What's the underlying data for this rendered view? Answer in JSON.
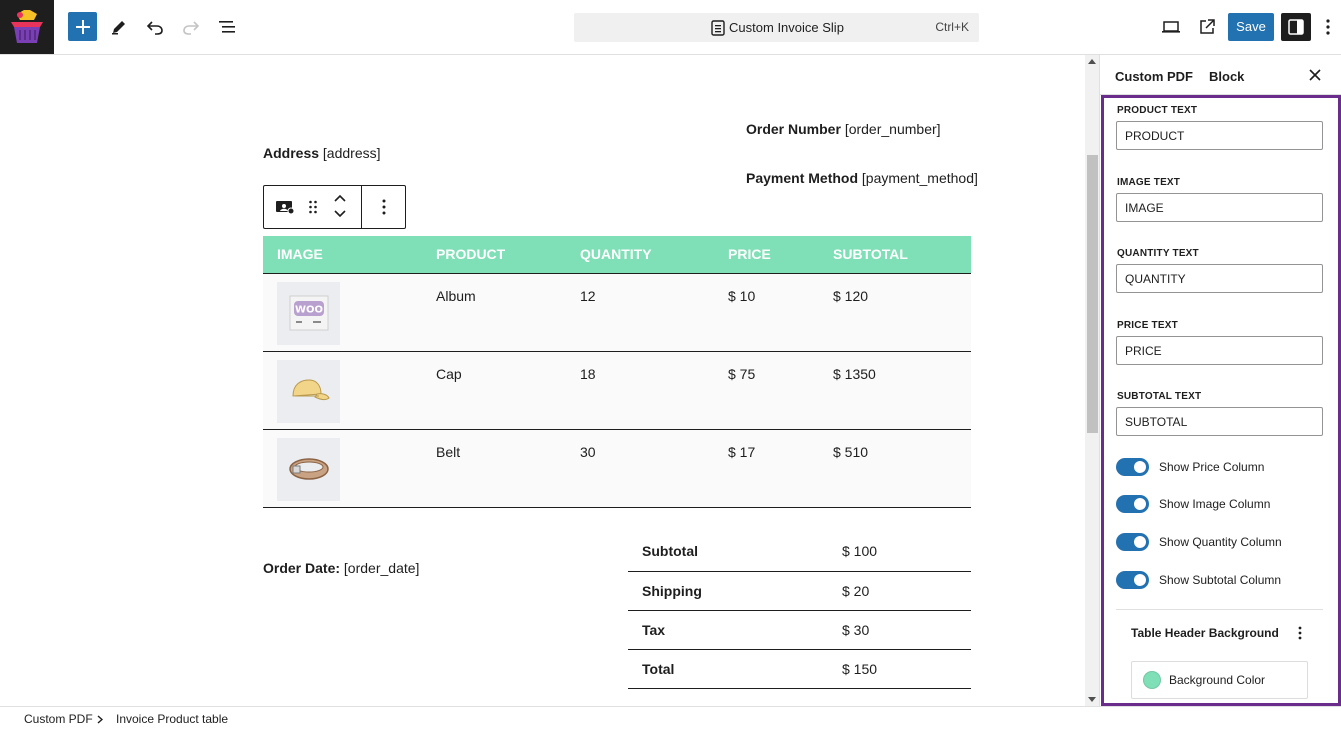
{
  "header": {
    "document_title": "Custom Invoice Slip",
    "shortcut": "Ctrl+K",
    "save_label": "Save"
  },
  "canvas": {
    "order_number": {
      "label": "Order Number",
      "value": "[order_number]"
    },
    "address": {
      "label": "Address",
      "value": "[address]"
    },
    "payment_method": {
      "label": "Payment Method",
      "value": "[payment_method]"
    },
    "order_date": {
      "label": "Order Date:",
      "value": "[order_date]"
    },
    "product_table": {
      "header_color": "#7fdfb6",
      "columns": [
        "IMAGE",
        "PRODUCT",
        "QUANTITY",
        "PRICE",
        "SUBTOTAL"
      ],
      "rows": [
        {
          "image_icon": "woo-album-image",
          "product": "Album",
          "quantity": "12",
          "price": "$ 10",
          "subtotal": "$ 120"
        },
        {
          "image_icon": "cap-image",
          "product": "Cap",
          "quantity": "18",
          "price": "$ 75",
          "subtotal": "$ 1350"
        },
        {
          "image_icon": "belt-image",
          "product": "Belt",
          "quantity": "30",
          "price": "$ 17",
          "subtotal": "$ 510"
        }
      ]
    },
    "totals": [
      {
        "label": "Subtotal",
        "value": "$ 100"
      },
      {
        "label": "Shipping",
        "value": "$ 20"
      },
      {
        "label": "Tax",
        "value": "$ 30"
      },
      {
        "label": "Total",
        "value": "$ 150"
      }
    ]
  },
  "sidebar": {
    "tabs": [
      "Custom PDF",
      "Block"
    ],
    "fields": [
      {
        "label": "PRODUCT TEXT",
        "value": "PRODUCT"
      },
      {
        "label": "IMAGE TEXT",
        "value": "IMAGE"
      },
      {
        "label": "QUANTITY TEXT",
        "value": "QUANTITY"
      },
      {
        "label": "PRICE TEXT",
        "value": "PRICE"
      },
      {
        "label": "SUBTOTAL TEXT",
        "value": "SUBTOTAL"
      }
    ],
    "toggles": [
      {
        "label": "Show Price Column",
        "on": true
      },
      {
        "label": "Show Image Column",
        "on": true
      },
      {
        "label": "Show Quantity Column",
        "on": true
      },
      {
        "label": "Show Subtotal Column",
        "on": true
      }
    ],
    "color_panel": {
      "title": "Table Header Background",
      "item_label": "Background Color",
      "swatch_color": "#7fdfb6"
    },
    "highlight_color": "#6b2d8b"
  },
  "breadcrumb": {
    "items": [
      "Custom PDF",
      "Invoice Product table"
    ]
  },
  "colors": {
    "accent": "#2271b1",
    "dark": "#1e1e1e"
  }
}
